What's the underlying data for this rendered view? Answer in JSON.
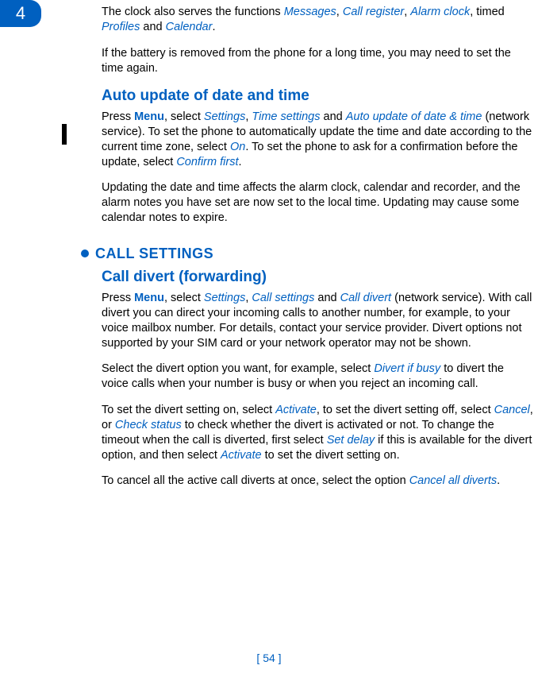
{
  "chapterNumber": "4",
  "pageFooter": "[ 54 ]",
  "intro": {
    "p1_a": "The clock also serves the functions ",
    "p1_messages": "Messages",
    "p1_b": ", ",
    "p1_callreg": "Call register",
    "p1_c": ", ",
    "p1_alarm": "Alarm clock",
    "p1_d": ", timed ",
    "p1_profiles": "Profiles",
    "p1_e": " and ",
    "p1_calendar": "Calendar",
    "p1_f": ".",
    "p2": "If the battery is removed from the phone for a long time, you may need to set the time again."
  },
  "autoUpdate": {
    "heading": "Auto update of date and time",
    "p1_a": "Press ",
    "p1_menu": "Menu",
    "p1_b": ", select ",
    "p1_settings": "Settings",
    "p1_c": ", ",
    "p1_timesettings": "Time settings",
    "p1_d": " and ",
    "p1_auto": "Auto update of date & time",
    "p1_e": " (network service). To set the phone to automatically update the time and date according to the current time zone, select ",
    "p1_on": "On",
    "p1_f": ". To set the phone to ask for a confirmation before the update, select ",
    "p1_confirm": "Confirm first",
    "p1_g": ".",
    "p2": "Updating the date and time affects the alarm clock, calendar and recorder, and the alarm notes you have set are now set to the local time. Updating may cause some calendar notes to expire."
  },
  "callSettings": {
    "sectionHeading": "CALL SETTINGS",
    "divert": {
      "heading": "Call divert (forwarding)",
      "p1_a": "Press ",
      "p1_menu": "Menu",
      "p1_b": ", select ",
      "p1_settings": "Settings",
      "p1_c": ", ",
      "p1_callsettings": "Call settings",
      "p1_d": " and ",
      "p1_calldivert": "Call divert",
      "p1_e": " (network service). With call divert you can direct your incoming calls to another number, for example, to your voice mailbox number. For details, contact your service provider. Divert options not supported by your SIM card or your network operator may not be shown.",
      "p2_a": "Select the divert option you want, for example, select ",
      "p2_divertbusy": "Divert if busy",
      "p2_b": " to divert the voice calls when your number is busy or when you reject an incoming call.",
      "p3_a": "To set the divert setting on, select ",
      "p3_activate": "Activate",
      "p3_b": ", to set the divert setting off, select ",
      "p3_cancel": "Cancel",
      "p3_c": ", or ",
      "p3_check": "Check status",
      "p3_d": " to check whether the divert is activated or not. To change the timeout when the call is diverted, first select ",
      "p3_setdelay": "Set delay",
      "p3_e": " if this is available for the divert option,  and then select ",
      "p3_activate2": "Activate",
      "p3_f": " to set the divert setting on.",
      "p4_a": "To cancel all the active call diverts at once, select the option ",
      "p4_cancelall": "Cancel all diverts",
      "p4_b": "."
    }
  }
}
